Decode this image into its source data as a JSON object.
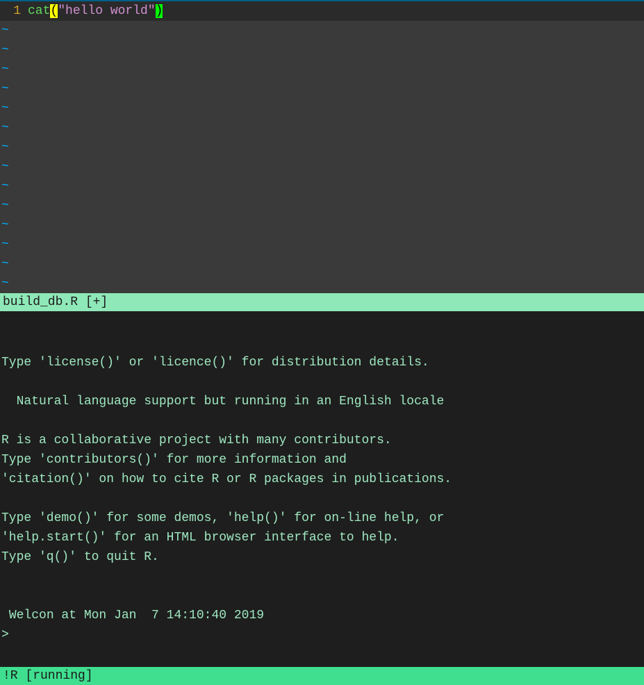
{
  "editor": {
    "line_number": "1",
    "fn": "cat",
    "open": "(",
    "string": "\"hello world\"",
    "close": ")",
    "tilde": "~",
    "tilde_count": 14
  },
  "status1": {
    "text": "build_db.R [+]"
  },
  "terminal": {
    "lines": [
      "Type 'license()' or 'licence()' for distribution details.",
      "",
      "  Natural language support but running in an English locale",
      "",
      "R is a collaborative project with many contributors.",
      "Type 'contributors()' for more information and",
      "'citation()' on how to cite R or R packages in publications.",
      "",
      "Type 'demo()' for some demos, 'help()' for on-line help, or",
      "'help.start()' for an HTML browser interface to help.",
      "Type 'q()' to quit R.",
      "",
      "",
      " Welcon at Mon Jan  7 14:10:40 2019",
      ">"
    ]
  },
  "status2": {
    "text": "!R [running]"
  }
}
